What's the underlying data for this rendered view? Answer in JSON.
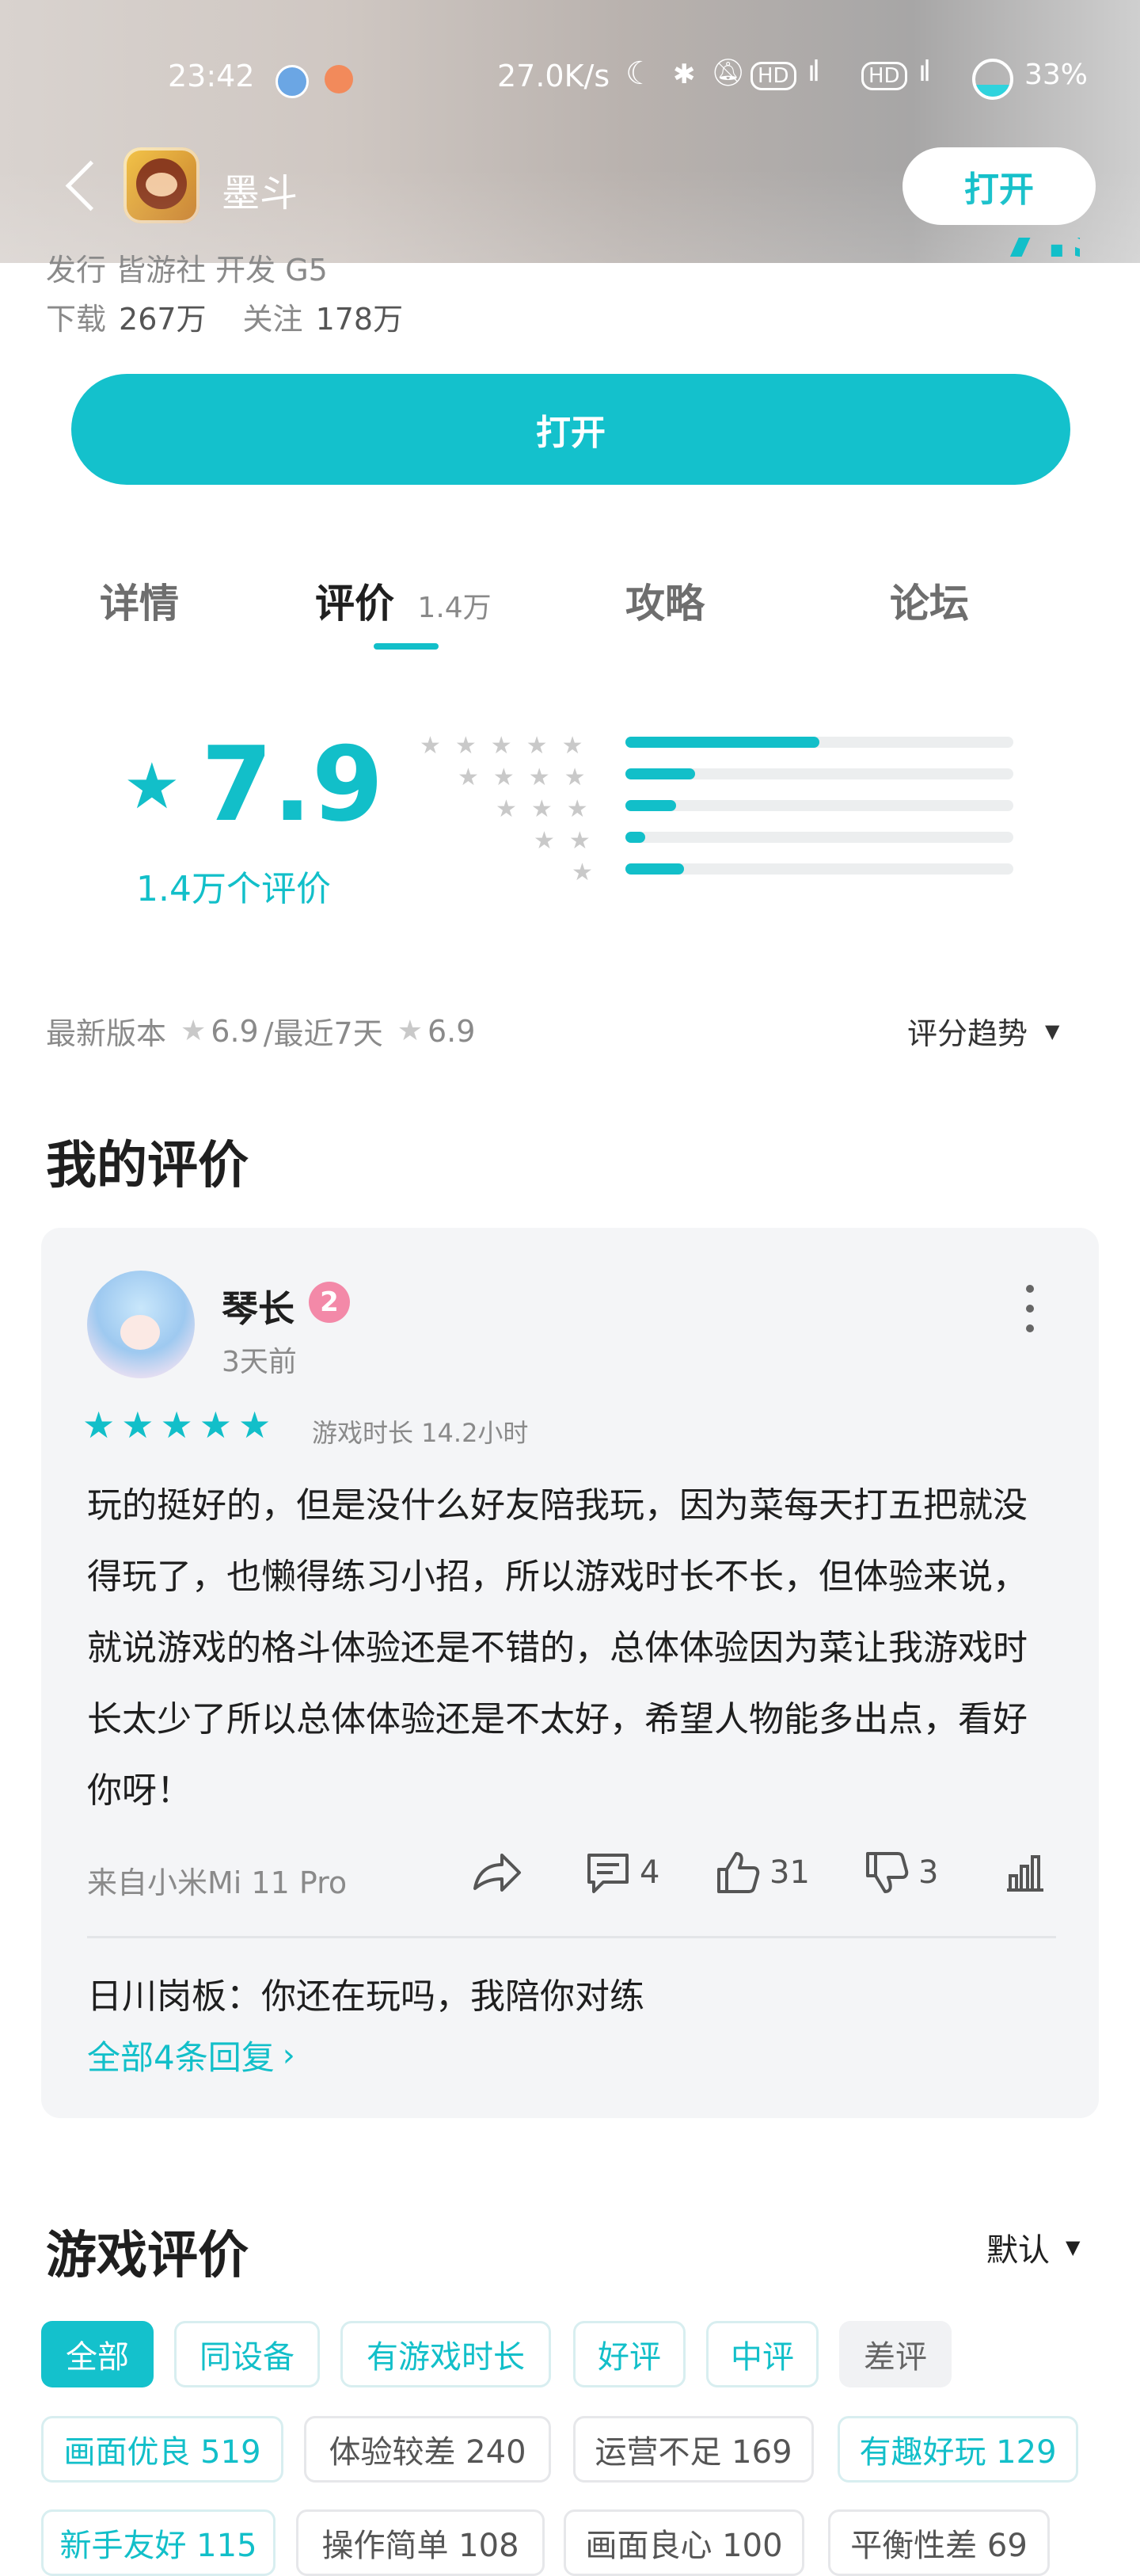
{
  "status_bar": {
    "time": "23:42",
    "speed": "27.0K/s",
    "battery": "33%"
  },
  "header": {
    "app_name": "墨斗",
    "open_label": "打开"
  },
  "meta": {
    "publisher_line": "发行 皆游社  开发 G5",
    "downloads_label": "下载",
    "downloads": "267万",
    "follows_label": "关注",
    "follows": "178万",
    "open_button": "打开"
  },
  "tabs": [
    {
      "label": "详情"
    },
    {
      "label": "评价",
      "count": "1.4万"
    },
    {
      "label": "攻略"
    },
    {
      "label": "论坛"
    }
  ],
  "rating": {
    "score": "7.9",
    "count_label": "1.4万个评价",
    "distribution": [
      {
        "stars": 5,
        "fraction": 0.5
      },
      {
        "stars": 4,
        "fraction": 0.18
      },
      {
        "stars": 3,
        "fraction": 0.13
      },
      {
        "stars": 2,
        "fraction": 0.05
      },
      {
        "stars": 1,
        "fraction": 0.15
      }
    ],
    "latest_version_label": "最新版本",
    "latest_version_score": "6.9",
    "recent_label": "/最近7天",
    "recent_score": "6.9",
    "trend_label": "评分趋势"
  },
  "my_review": {
    "section_title": "我的评价",
    "user_name": "琴长",
    "level": "2",
    "time_ago": "3天前",
    "stars": 5,
    "play_time": "游戏时长 14.2小时",
    "text": "玩的挺好的，但是没什么好友陪我玩，因为菜每天打五把就没得玩了，也懒得练习小招，所以游戏时长不长，但体验来说，就说游戏的格斗体验还是不错的，总体体验因为菜让我游戏时长太少了所以总体体验还是不太好，希望人物能多出点，看好你呀！",
    "device": "来自小米Mi 11 Pro",
    "comments": "4",
    "likes": "31",
    "dislikes": "3",
    "reply_preview": "日川岗板：你还在玩吗，我陪你对练",
    "all_replies": "全部4条回复"
  },
  "game_reviews": {
    "section_title": "游戏评价",
    "sort_label": "默认",
    "filters_row1": [
      "全部",
      "同设备",
      "有游戏时长",
      "好评",
      "中评",
      "差评"
    ],
    "filters_row2": [
      "画面优良 519",
      "体验较差 240",
      "运营不足 169",
      "有趣好玩 129"
    ],
    "filters_row3": [
      "新手友好 115",
      "操作简单 108",
      "画面良心 100",
      "平衡性差 69"
    ]
  },
  "colors": {
    "accent": "#14c1cc",
    "badge": "#f389a8"
  }
}
